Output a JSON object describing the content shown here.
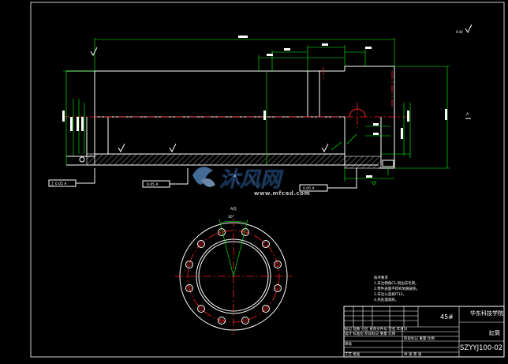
{
  "colors": {
    "background": "#000000",
    "outline": "#ffffff",
    "dimension": "#00ff00",
    "centerline": "#ff2020",
    "watermark": "#5b8fc7"
  },
  "watermark": {
    "brand": "沐风网",
    "url": "www.mfcad.com"
  },
  "views": {
    "top_right_note": "0.8/",
    "section_label": "A",
    "circle_view_label": "A向",
    "circle_angle": "30°"
  },
  "datum_labels": [
    "上 0.05 A",
    "0.05 A",
    "0.05 A"
  ],
  "tech_notes": {
    "title": "技术要求",
    "lines": [
      "1.未注倒角C1,锐边去毛刺。",
      "2.零件表面不得有划痕碰伤。",
      "3.未注公差按IT12。",
      "4.热处理调质。"
    ]
  },
  "title_block": {
    "material": "45#",
    "school": "华东科技学院",
    "part_name": "缸筒",
    "drawing_no": "SZYYJ100-02",
    "rows": [
      "标记 处数 分区 更改文件号 签名 年月日",
      "设计 标准化 阶段标记 重量 比例",
      "审核",
      "工艺 批准"
    ],
    "scale_row": "阶段标记 重量 比例",
    "sheet_row": "共 张 第 张"
  }
}
